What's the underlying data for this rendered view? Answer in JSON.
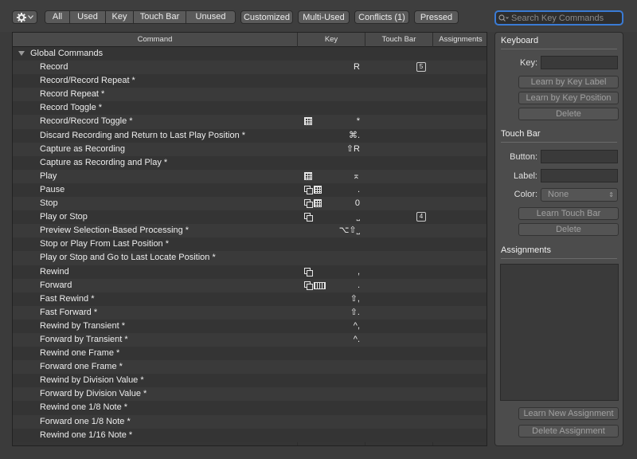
{
  "toolbar": {
    "filters": [
      "All",
      "Used",
      "Key",
      "Touch Bar",
      "Unused"
    ],
    "customized": "Customized",
    "multi_used": "Multi-Used",
    "conflicts": "Conflicts (1)",
    "pressed": "Pressed"
  },
  "search": {
    "placeholder": "Search Key Commands"
  },
  "table": {
    "columns": [
      "Command",
      "Key",
      "Touch Bar",
      "Assignments"
    ],
    "rows": [
      {
        "name": "Global Commands",
        "group": true,
        "key": "",
        "icons": [],
        "touchbar": ""
      },
      {
        "name": "Record",
        "key": "R",
        "icons": [],
        "touchbar": "5"
      },
      {
        "name": "Record/Record Repeat *",
        "key": "",
        "icons": [],
        "touchbar": ""
      },
      {
        "name": "Record Repeat *",
        "key": "",
        "icons": [],
        "touchbar": ""
      },
      {
        "name": "Record Toggle *",
        "key": "",
        "icons": [],
        "touchbar": ""
      },
      {
        "name": "Record/Record Toggle *",
        "key": "*",
        "icons": [
          "grid-icon"
        ],
        "touchbar": ""
      },
      {
        "name": "Discard Recording and Return to Last Play Position *",
        "key": "⌘.",
        "icons": [],
        "touchbar": ""
      },
      {
        "name": "Capture as Recording",
        "key": "⇧R",
        "icons": [],
        "touchbar": ""
      },
      {
        "name": "Capture as Recording and Play *",
        "key": "",
        "icons": [],
        "touchbar": ""
      },
      {
        "name": "Play",
        "key": "⌅",
        "icons": [
          "grid-icon"
        ],
        "touchbar": ""
      },
      {
        "name": "Pause",
        "key": ".",
        "icons": [
          "window-icon",
          "grid-icon"
        ],
        "touchbar": ""
      },
      {
        "name": "Stop",
        "key": "0",
        "icons": [
          "window-icon",
          "grid-icon"
        ],
        "touchbar": ""
      },
      {
        "name": "Play or Stop",
        "key": "˽",
        "icons": [
          "window-icon"
        ],
        "touchbar": "4"
      },
      {
        "name": "Preview Selection-Based Processing *",
        "key": "⌥⇧˽",
        "icons": [],
        "touchbar": ""
      },
      {
        "name": "Stop or Play From Last Position *",
        "key": "",
        "icons": [],
        "touchbar": ""
      },
      {
        "name": "Play or Stop and Go to Last Locate Position *",
        "key": "",
        "icons": [],
        "touchbar": ""
      },
      {
        "name": "Rewind",
        "key": ",",
        "icons": [
          "window-icon"
        ],
        "touchbar": ""
      },
      {
        "name": "Forward",
        "key": ".",
        "icons": [
          "window-icon",
          "keyboard-icon"
        ],
        "touchbar": ""
      },
      {
        "name": "Fast Rewind *",
        "key": "⇧,",
        "icons": [],
        "touchbar": ""
      },
      {
        "name": "Fast Forward *",
        "key": "⇧.",
        "icons": [],
        "touchbar": ""
      },
      {
        "name": "Rewind by Transient *",
        "key": "^,",
        "icons": [],
        "touchbar": ""
      },
      {
        "name": "Forward by Transient *",
        "key": "^.",
        "icons": [],
        "touchbar": ""
      },
      {
        "name": "Rewind one Frame *",
        "key": "",
        "icons": [],
        "touchbar": ""
      },
      {
        "name": "Forward one Frame *",
        "key": "",
        "icons": [],
        "touchbar": ""
      },
      {
        "name": "Rewind by Division Value *",
        "key": "",
        "icons": [],
        "touchbar": ""
      },
      {
        "name": "Forward by Division Value *",
        "key": "",
        "icons": [],
        "touchbar": ""
      },
      {
        "name": "Rewind one 1/8 Note *",
        "key": "",
        "icons": [],
        "touchbar": ""
      },
      {
        "name": "Forward one 1/8 Note *",
        "key": "",
        "icons": [],
        "touchbar": ""
      },
      {
        "name": "Rewind one 1/16 Note *",
        "key": "",
        "icons": [],
        "touchbar": ""
      }
    ]
  },
  "panel": {
    "keyboard": {
      "title": "Keyboard",
      "key_label": "Key:",
      "key_value": "",
      "learn_label_btn": "Learn by Key Label",
      "learn_position_btn": "Learn by Key Position",
      "delete_btn": "Delete"
    },
    "touchbar": {
      "title": "Touch Bar",
      "button_label": "Button:",
      "button_value": "",
      "label_label": "Label:",
      "label_value": "",
      "color_label": "Color:",
      "color_value": "None",
      "learn_btn": "Learn Touch Bar",
      "delete_btn": "Delete"
    },
    "assignments": {
      "title": "Assignments",
      "learn_new_btn": "Learn New Assignment",
      "delete_btn": "Delete Assignment"
    }
  },
  "colors": {
    "accent": "#3a7bd5",
    "background": "#3b3b3b",
    "panel": "#4c4c4c"
  }
}
